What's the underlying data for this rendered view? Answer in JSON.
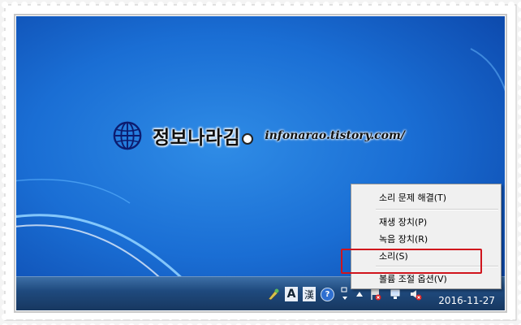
{
  "brand": {
    "title": "정보나라김",
    "url": "infonarao.tistory.com/"
  },
  "context_menu": {
    "items": [
      {
        "label": "소리 문제 해결(T)"
      },
      {
        "label": "재생 장치(P)"
      },
      {
        "label": "녹음 장치(R)"
      },
      {
        "label": "소리(S)"
      },
      {
        "label": "볼륨 조절 옵션(V)"
      }
    ]
  },
  "taskbar": {
    "ime_mode": "A",
    "ime_hanja": "漢",
    "ime_help": "?",
    "date": "2016-11-27"
  },
  "icons": [
    "globe-icon",
    "ime-tool-icon",
    "ime-help-icon",
    "flag-icon",
    "network-icon",
    "speaker-icon",
    "show-hidden-icons-icon"
  ],
  "colors": {
    "highlight_border": "#d0141c",
    "desktop_blue": "#1a6ed4"
  }
}
